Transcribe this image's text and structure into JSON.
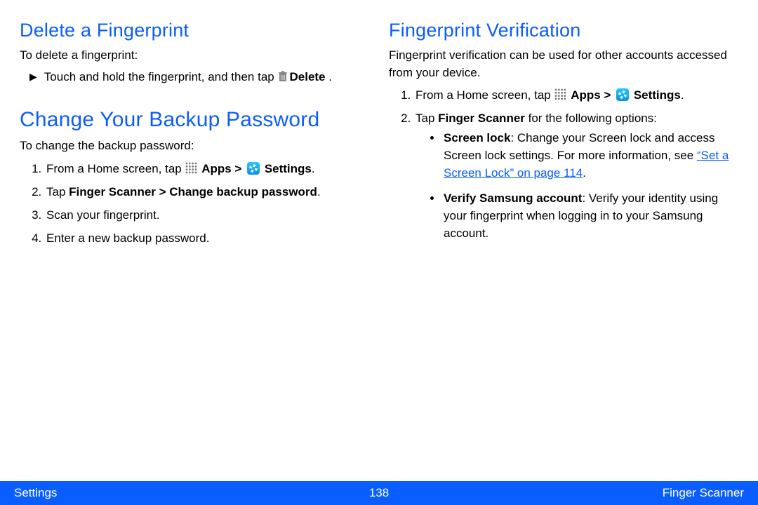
{
  "left": {
    "h_delete": "Delete a Fingerprint",
    "p_delete": "To delete a fingerprint:",
    "bullet_delete_a": "Touch and hold the fingerprint, and then tap",
    "bullet_delete_b": "Delete",
    "bullet_delete_c": " .",
    "h_change": "Change Your Backup Password",
    "p_change": "To change the backup password:",
    "step1_a": "From a Home screen, tap ",
    "apps_label": "Apps",
    "gt": " > ",
    "settings_label": "Settings",
    "step1_d": ".",
    "step2_a": "Tap ",
    "step2_b": "Finger Scanner > Change backup password",
    "step2_c": ".",
    "step3": "Scan your fingerprint.",
    "step4": "Enter a new backup password."
  },
  "right": {
    "h_verify": "Fingerprint Verification",
    "p_verify": "Fingerprint verification can be used for other accounts accessed from your device.",
    "step1_a": "From a Home screen, tap ",
    "apps_label": "Apps",
    "gt": " > ",
    "settings_label": "Settings",
    "step1_d": ".",
    "step2_a": "Tap ",
    "step2_b": "Finger Scanner",
    "step2_c": " for the following options:",
    "sub1_a": "Screen lock",
    "sub1_b": ": Change your Screen lock and access Screen lock settings. For more information, see ",
    "sub1_link": "“Set a Screen Lock” on page 114",
    "sub1_c": ".",
    "sub2_a": "Verify Samsung account",
    "sub2_b": ": Verify your identity using your fingerprint when logging in to your Samsung account."
  },
  "footer": {
    "left": "Settings",
    "center": "138",
    "right": "Finger Scanner"
  }
}
